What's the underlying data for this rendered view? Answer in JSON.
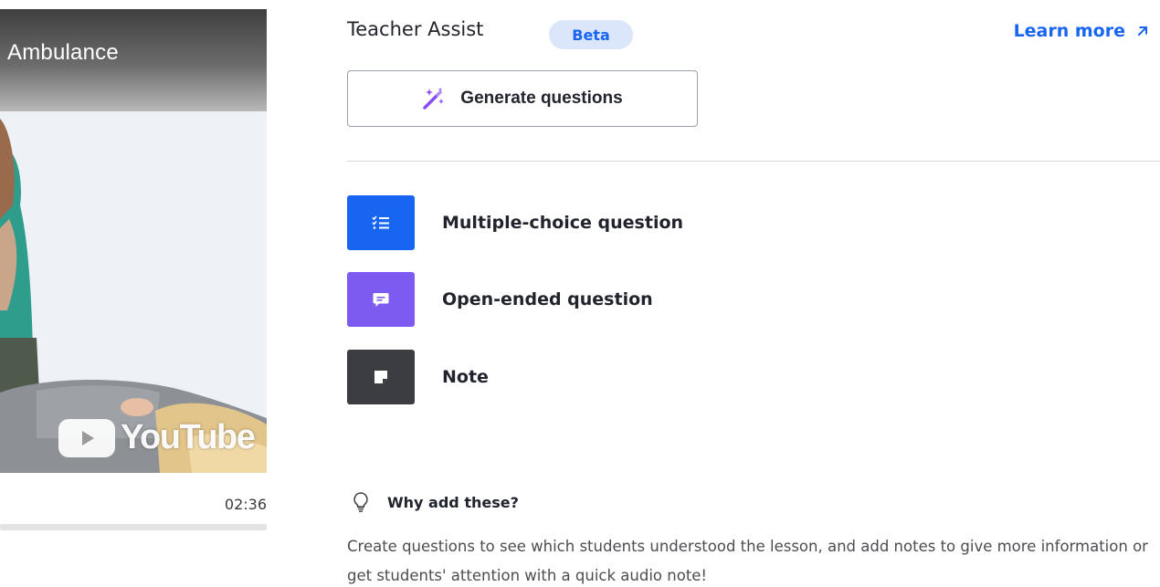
{
  "video": {
    "title": "Ambulance",
    "watermark": "YouTube",
    "duration": "02:36",
    "progress": 0
  },
  "assist": {
    "title": "Teacher Assist",
    "badge": "Beta",
    "learn_more": "Learn more",
    "generate_label": "Generate questions"
  },
  "actions": [
    {
      "label": "Multiple-choice question",
      "icon": "checklist-icon",
      "color": "#1865f2"
    },
    {
      "label": "Open-ended question",
      "icon": "chat-bubble-icon",
      "color": "#7d5bf0"
    },
    {
      "label": "Note",
      "icon": "sticky-note-icon",
      "color": "#3b3d42"
    }
  ],
  "why": {
    "title": "Why add these?",
    "description": "Create questions to see which students understood the lesson, and add notes to give more information or get students' attention with a quick audio note!"
  },
  "colors": {
    "accent": "#1865f2",
    "beta_bg": "#dbe6fb",
    "wand": "#8a4df2"
  }
}
